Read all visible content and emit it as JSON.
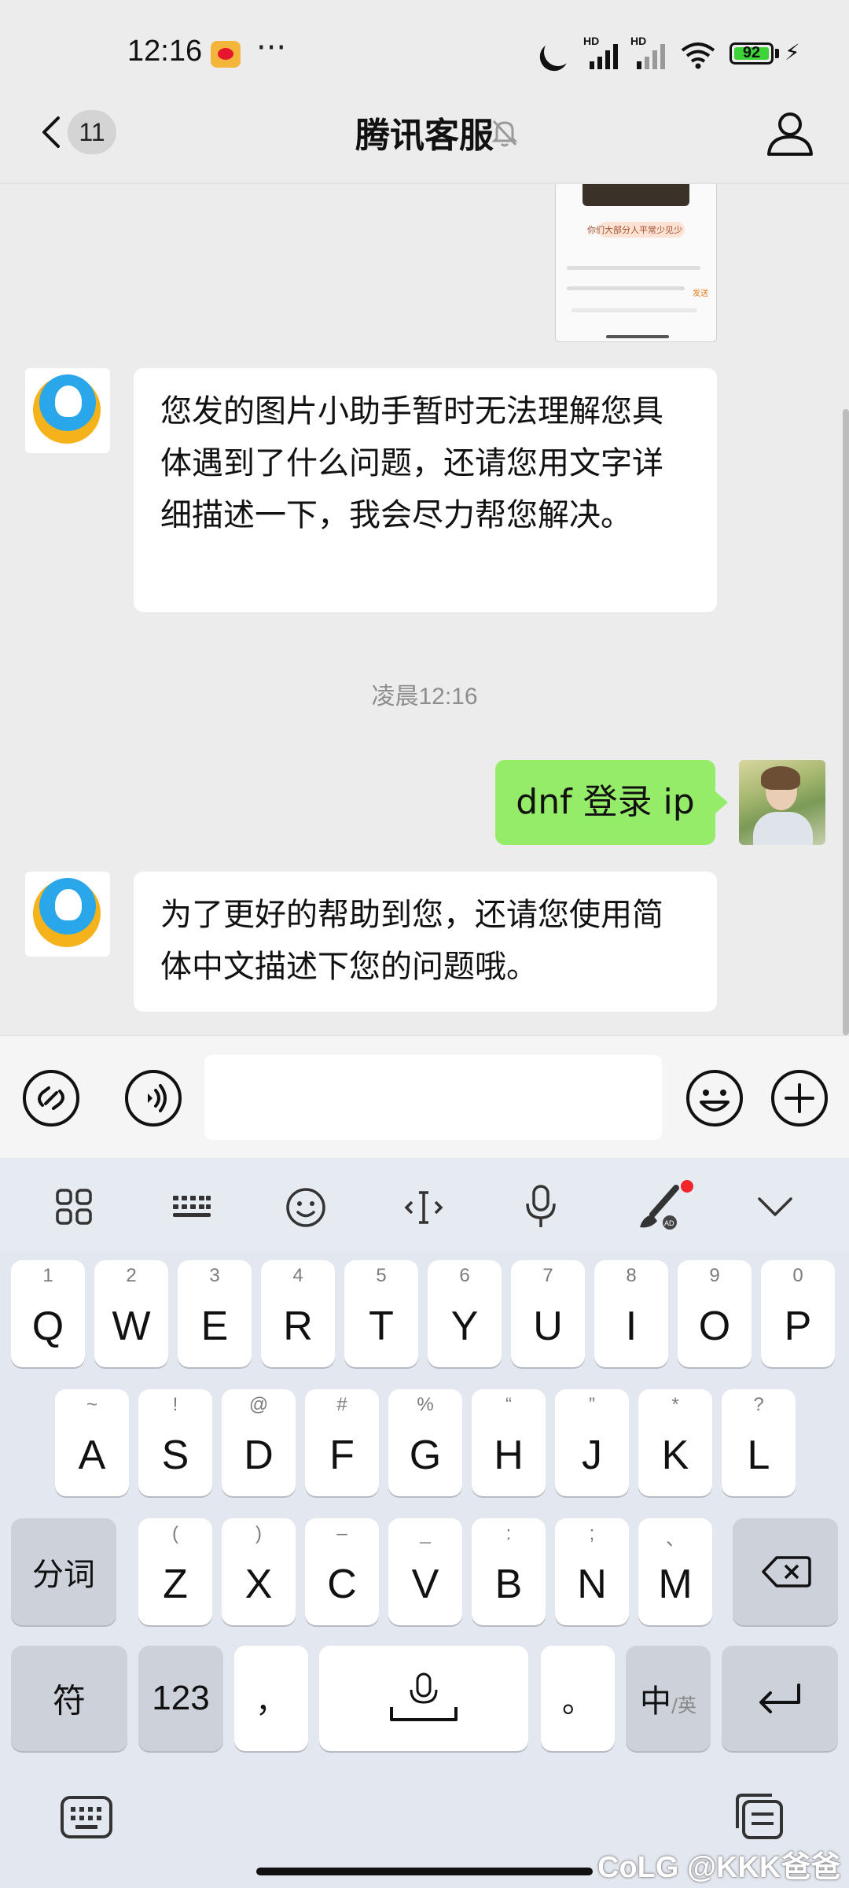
{
  "status_bar": {
    "time": "12:16",
    "more": "···",
    "hd1": "HD",
    "hd2": "HD",
    "battery": "92"
  },
  "header": {
    "back_count": "11",
    "title": "腾讯客服"
  },
  "messages": {
    "bot1": "您发的图片小助手暂时无法理解您具体遇到了什么问题，还请您用文字详细描述一下，我会尽力帮您解决。",
    "timestamp": "凌晨12:16",
    "user1": "dnf 登录 ip",
    "bot2": "为了更好的帮助到您，还请您使用简体中文描述下您的问题哦。"
  },
  "thumbnail": {
    "caption": "你们大部分人平常少见少",
    "send": "发送"
  },
  "input": {
    "value": ""
  },
  "keyboard": {
    "row1": [
      {
        "k": "Q",
        "s": "1"
      },
      {
        "k": "W",
        "s": "2"
      },
      {
        "k": "E",
        "s": "3"
      },
      {
        "k": "R",
        "s": "4"
      },
      {
        "k": "T",
        "s": "5"
      },
      {
        "k": "Y",
        "s": "6"
      },
      {
        "k": "U",
        "s": "7"
      },
      {
        "k": "I",
        "s": "8"
      },
      {
        "k": "O",
        "s": "9"
      },
      {
        "k": "P",
        "s": "0"
      }
    ],
    "row2": [
      {
        "k": "A",
        "s": "~"
      },
      {
        "k": "S",
        "s": "!"
      },
      {
        "k": "D",
        "s": "@"
      },
      {
        "k": "F",
        "s": "#"
      },
      {
        "k": "G",
        "s": "%"
      },
      {
        "k": "H",
        "s": "“"
      },
      {
        "k": "J",
        "s": "”"
      },
      {
        "k": "K",
        "s": "*"
      },
      {
        "k": "L",
        "s": "?"
      }
    ],
    "row3": [
      {
        "k": "Z",
        "s": "("
      },
      {
        "k": "X",
        "s": ")"
      },
      {
        "k": "C",
        "s": "–"
      },
      {
        "k": "V",
        "s": "_"
      },
      {
        "k": "B",
        "s": ":"
      },
      {
        "k": "N",
        "s": ";"
      },
      {
        "k": "M",
        "s": "、"
      }
    ],
    "fenci": "分词",
    "fu": "符",
    "num": "123",
    "comma": "，",
    "period": "。",
    "lang_main": "中",
    "lang_alt": "/英"
  },
  "watermark": "CoLG @KKK爸爸"
}
